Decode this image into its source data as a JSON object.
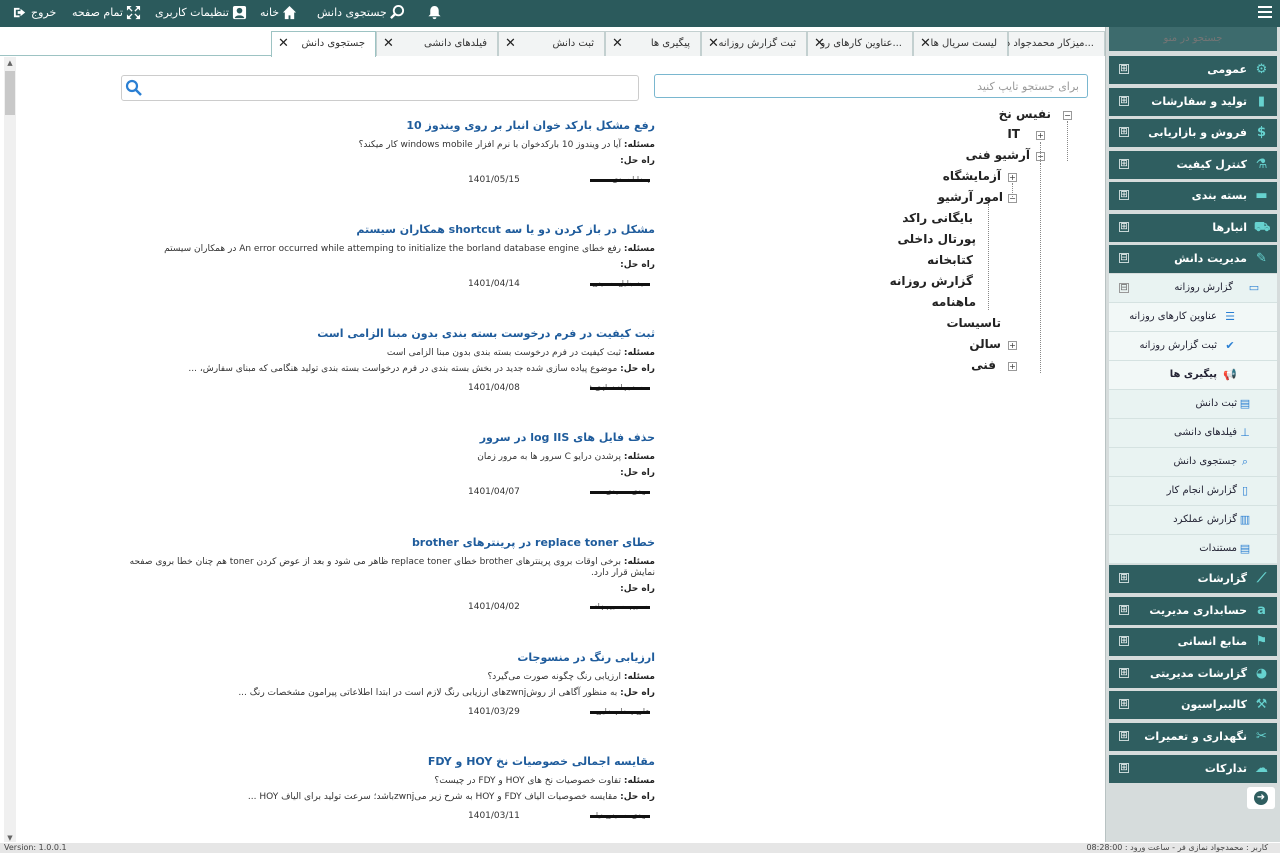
{
  "topbar": {
    "logout": "خروج",
    "fullscreen": "تمام صفحه",
    "user_settings": "تنظیمات کاربری",
    "home": "خانه",
    "knowledge_search": "جستجوی دانش"
  },
  "sidebar": {
    "search_placeholder": "جستجو در منو",
    "menus": [
      {
        "label": "عمومی",
        "icon": "gears-icon"
      },
      {
        "label": "تولید و سفارشات",
        "icon": "clipboard-icon"
      },
      {
        "label": "فروش و بازاریابی",
        "icon": "dollar-icon"
      },
      {
        "label": "کنترل کیفیت",
        "icon": "flask-icon"
      },
      {
        "label": "بسته بندی",
        "icon": "box-icon"
      },
      {
        "label": "انبارها",
        "icon": "truck-icon"
      },
      {
        "label": "مدیریت دانش",
        "icon": "scroll-icon"
      },
      {
        "label": "گزارشات",
        "icon": "chart-icon"
      },
      {
        "label": "حسابداری مدیریت",
        "icon": "amazon-icon"
      },
      {
        "label": "منابع انسانی",
        "icon": "flag-icon"
      },
      {
        "label": "گزارشات مدیریتی",
        "icon": "dashboard-icon"
      },
      {
        "label": "کالیبراسیون",
        "icon": "wrench-icon"
      },
      {
        "label": "نگهداری و تعمیرات",
        "icon": "tools-icon"
      },
      {
        "label": "تدارکات",
        "icon": "cloud-icon"
      }
    ],
    "km_submenu": {
      "daily_report": "گزارش روزانه",
      "daily_items": [
        "عناوین کارهای روزانه",
        "ثبت گزارش روزانه",
        "پیگیری ها"
      ],
      "items": [
        "ثبت دانش",
        "فیلدهای دانشی",
        "جستجوی دانش",
        "گزارش انجام کار",
        "گزارش عملکرد",
        "مستندات"
      ]
    },
    "toggle_expand": "⊞",
    "toggle_collapse": "⊟"
  },
  "tabs": [
    {
      "label": "میزکار محمدجواد د..."
    },
    {
      "label": "لیست سریال ها"
    },
    {
      "label": "عناوین کارهای رو..."
    },
    {
      "label": "ثبت گزارش روزانه"
    },
    {
      "label": "پیگیری ها"
    },
    {
      "label": "ثبت دانش"
    },
    {
      "label": "فیلدهای دانشی"
    },
    {
      "label": "جستجوی دانش"
    }
  ],
  "tree": {
    "search_placeholder": "برای جستجو تایپ کنید",
    "nodes": [
      "نفیس نخ",
      "IT",
      "آرشیو فنی",
      "آزمایشگاه",
      "امور آرشیو",
      "بایگانی راکد",
      "پورتال داخلی",
      "کتابخانه",
      "گزارش روزانه",
      "ماهنامه",
      "تاسیسات",
      "سالن",
      "فنی"
    ]
  },
  "labels": {
    "problem": "مسئله:",
    "solution": "راه حل:"
  },
  "results": [
    {
      "title": "رفع مشکل بارکد خوان انبار بر روی ویندوز 10",
      "problem": "آیا در ویندوز 10 بارکدخوان با نرم افزار windows mobile کار میکند؟",
      "solution": "",
      "date": "1401/05/15",
      "author": "رضا احمدی"
    },
    {
      "title": "مشکل در باز کردن دو یا سه shortcut همکاران سیستم",
      "problem": "رفع خطای An error occurred while attemping to initialize the borland database engine در همکاران سیستم",
      "solution": "",
      "date": "1401/04/14",
      "author": "سید جلیل حسینی"
    },
    {
      "title": "ثبت کیفیت در فرم درخوست بسته بندی بدون مبنا الزامی است",
      "problem": "ثبت کیفیت در فرم درخوست بسته بندی بدون مبنا الزامی است",
      "solution": "موضوع پیاده سازی شده جدید در بخش بسته بندی در فرم درخواست بسته بندی تولید هنگامی که مبنای سفارش، ...",
      "date": "1401/04/08",
      "author": "محمدجواد نمازی فر"
    },
    {
      "title": "حذف فایل های log IIS در سرور",
      "problem": "پرشدن درایو C سرور ها به مرور زمان",
      "solution": "",
      "date": "1401/04/07",
      "author": "مهدی سعیدی"
    },
    {
      "title": "خطای replace toner در پرینترهای brother",
      "problem": "برخی اوقات بروی پرینترهای brother خطای replace toner ظاهر می شود و بعد از عوض کردن toner هم چنان خطا بروی صفحه نمایش قرار دارد.",
      "solution": "",
      "date": "1401/04/02",
      "author": "حسین حسین زاده"
    },
    {
      "title": "ارزیابی رنگ در منسوجات",
      "problem": "ارزیابی رنگ چگونه صورت می‌گیرد؟",
      "solution": "به منظور آگاهی از روش‌zwnjهای ارزیابی رنگ لازم است در ابتدا اطلاعاتی پیرامون مشخصات رنگ ...",
      "date": "1401/03/29",
      "author": "علی رضا رضایی"
    },
    {
      "title": "مقایسه اجمالی خصوصیات نخ HOY و FDY",
      "problem": "تفاوت خصوصیات نخ های HOY و FDY در چیست؟",
      "solution": "مقایسه خصوصیات الیاف FDY و HOY به شرح زیر می‌zwnjباشد؛ سرعت تولید برای الیاف HOY ...",
      "date": "1401/03/11",
      "author": "مهدی حسینی نیا"
    }
  ],
  "statusbar": {
    "version": "Version: 1.0.0.1",
    "user": "کاربر : محمدجواد نمازی فر - ساعت ورود : 08:28:00"
  },
  "colors": {
    "topbar": "#2b5a5c",
    "menu": "#2f5e60",
    "link": "#1f5c9c"
  }
}
